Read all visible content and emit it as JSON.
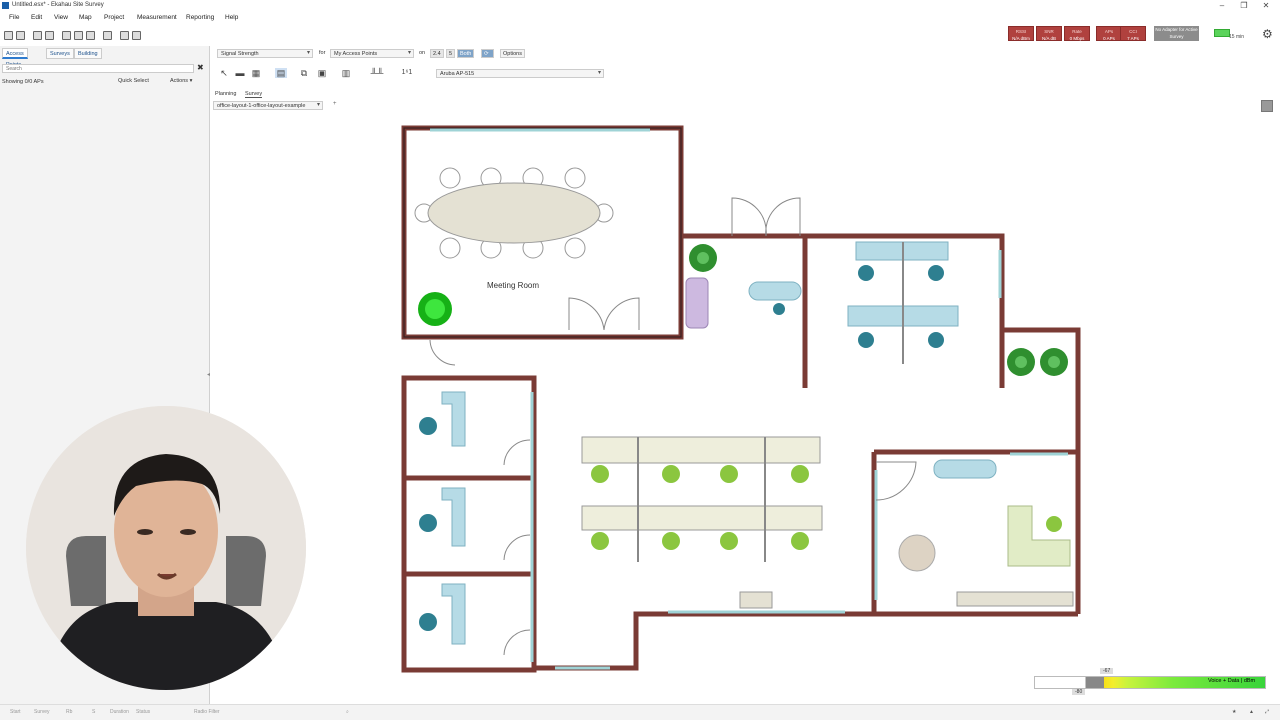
{
  "window": {
    "title": "Untitled.esx* - Ekahau Site Survey"
  },
  "menu": [
    "File",
    "Edit",
    "View",
    "Map",
    "Project",
    "Measurement",
    "Reporting",
    "Help"
  ],
  "status_chips": [
    {
      "value": "N/A dBm",
      "color": "#b0413e"
    },
    {
      "value": "N/A dB",
      "color": "#b0413e"
    },
    {
      "value": "0 Mbps",
      "color": "#b0413e"
    },
    {
      "value": "0 APs",
      "color": "#b0413e"
    },
    {
      "value": "7 APs",
      "color": "#b0413e"
    }
  ],
  "adapter_status": "No Adapter for Active Survey",
  "battery_label": "15 min",
  "left_panel": {
    "tabs": [
      "Access Points",
      "Surveys",
      "Building"
    ],
    "search_placeholder": "Search",
    "showing": "Showing 0/0 APs",
    "quick_select": "Quick Select",
    "actions": "Actions"
  },
  "toolbar": {
    "visualization": "Signal Strength",
    "for_label": "for",
    "ap_filter": "My Access Points",
    "on_label": "on",
    "bands": [
      "2.4",
      "5",
      "Both"
    ],
    "options": "Options",
    "ap_model": "Aruba AP-515",
    "icons": [
      "pointer-icon",
      "wall-icon",
      "area-icon",
      "floor-icon",
      "copy-icon",
      "paste-icon",
      "building-icon",
      "measure-icon",
      "auto-planner-icon"
    ]
  },
  "mode_tabs": [
    "Planning",
    "Survey"
  ],
  "floor": {
    "name": "office-layout-1-office-layout-example"
  },
  "map": {
    "room_label": "Meeting Room"
  },
  "legend": {
    "top_value": "-67",
    "bottom_value": "-80",
    "text": "Voice + Data | dBm",
    "accent": "#38d43b"
  },
  "bottombar": [
    "Start",
    "Survey",
    "Rb",
    "S",
    "Duration",
    "Status",
    "Radio Filter"
  ]
}
